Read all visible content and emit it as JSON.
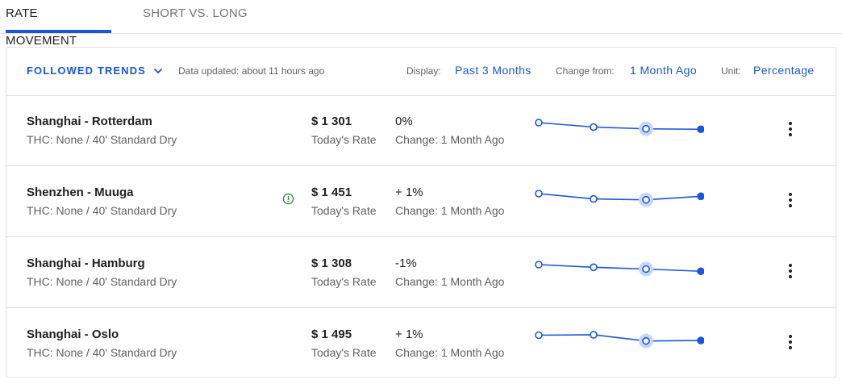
{
  "tabs": [
    {
      "label": "RATE MOVEMENT"
    },
    {
      "label": "SHORT VS. LONG"
    }
  ],
  "header": {
    "followed_label": "FOLLOWED TRENDS",
    "updated": "Data updated: about 11 hours ago",
    "display_label": "Display:",
    "display_value": "Past 3 Months",
    "change_label": "Change from:",
    "change_value": "1 Month Ago",
    "unit_label": "Unit:",
    "unit_value": "Percentage"
  },
  "colors": {
    "accent": "#1a56db",
    "alert": "#2e7d32"
  },
  "rows": [
    {
      "route": "Shanghai - Rotterdam",
      "subtitle": "THC: None / 40' Standard Dry",
      "price": "$ 1 301",
      "price_label": "Today's Rate",
      "change": "0%",
      "change_label": "Change: 1 Month Ago",
      "alert": false,
      "trend": [
        1.0,
        0.0,
        -0.4,
        -0.5
      ]
    },
    {
      "route": "Shenzhen - Muuga",
      "subtitle": "THC: None / 40' Standard Dry",
      "price": "$ 1 451",
      "price_label": "Today's Rate",
      "change": "+ 1%",
      "change_label": "Change: 1 Month Ago",
      "alert": true,
      "trend": [
        1.0,
        -0.2,
        -0.4,
        0.4
      ]
    },
    {
      "route": "Shanghai - Hamburg",
      "subtitle": "THC: None / 40' Standard Dry",
      "price": "$ 1 308",
      "price_label": "Today's Rate",
      "change": "-1%",
      "change_label": "Change: 1 Month Ago",
      "alert": false,
      "trend": [
        1.0,
        0.4,
        0.0,
        -0.5
      ]
    },
    {
      "route": "Shanghai - Oslo",
      "subtitle": "THC: None / 40' Standard Dry",
      "price": "$ 1 495",
      "price_label": "Today's Rate",
      "change": "+ 1%",
      "change_label": "Change: 1 Month Ago",
      "alert": false,
      "trend": [
        0.0,
        0.1,
        -1.3,
        -1.2
      ]
    }
  ]
}
